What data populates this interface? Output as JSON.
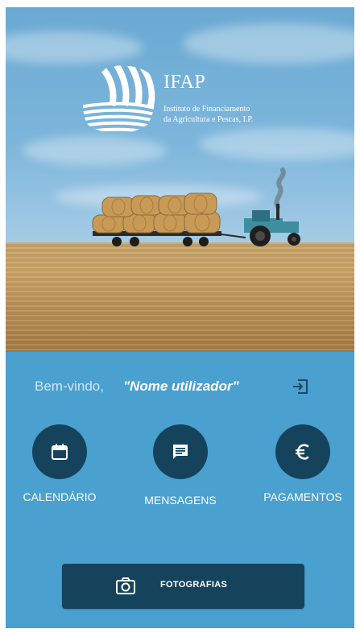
{
  "brand": {
    "name": "IFAP",
    "subtitle_line1": "Instituto de Financiamento",
    "subtitle_line2": "da Agricultura e Pescas, I.P."
  },
  "welcome": {
    "greeting": "Bem-vindo,",
    "username": "\"Nome utilizador\""
  },
  "actions": [
    {
      "label": "CALENDÁRIO",
      "icon": "calendar-icon"
    },
    {
      "label": "MENSAGENS",
      "icon": "message-icon"
    },
    {
      "label": "PAGAMENTOS",
      "icon": "euro-icon"
    }
  ],
  "photo_button": {
    "label": "FOTOGRAFIAS",
    "icon": "camera-icon"
  },
  "logout_icon": "logout-icon",
  "colors": {
    "panel": "#4aa0cf",
    "button_dark": "#16435c",
    "text_light": "#ffffff",
    "greeting_text": "#cfe6f4"
  }
}
